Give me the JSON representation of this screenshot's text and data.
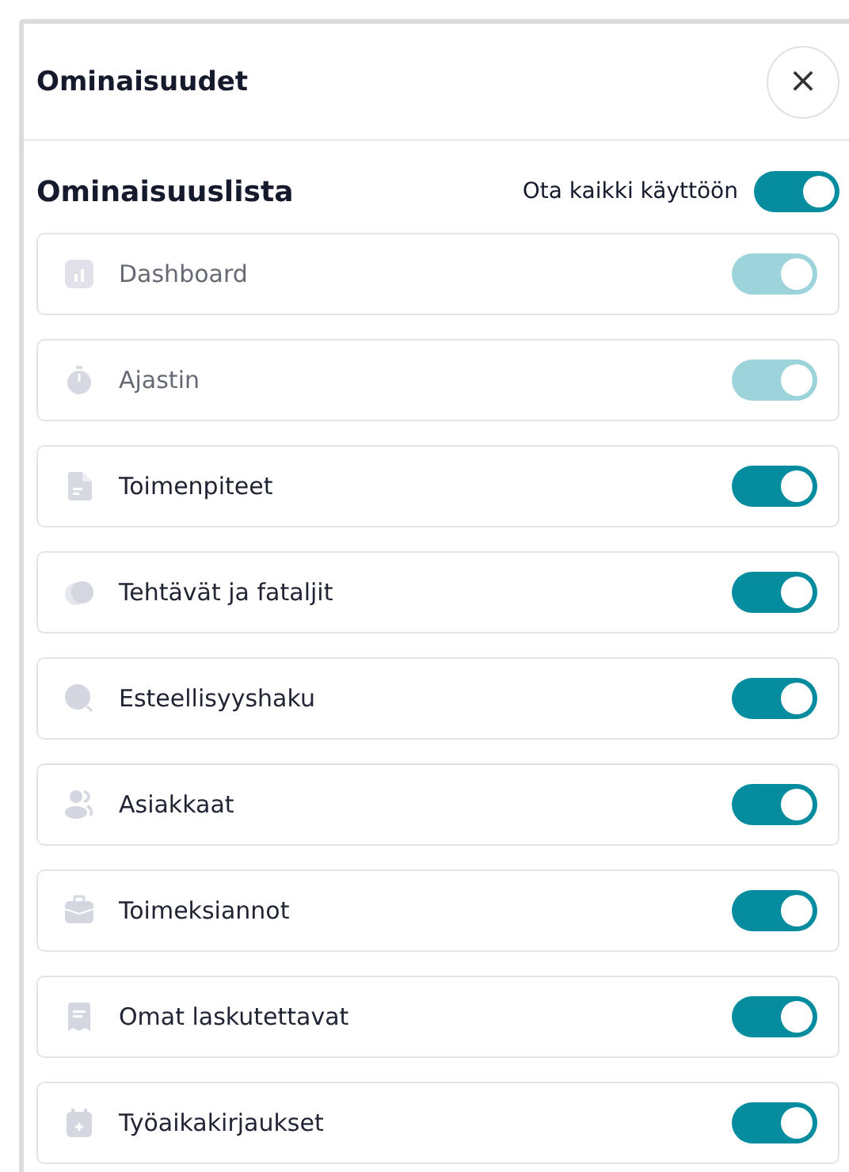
{
  "panel": {
    "title": "Ominaisuudet",
    "close_label": "×"
  },
  "section": {
    "title": "Ominaisuuslista",
    "enable_all_label": "Ota kaikki käyttöön",
    "enable_all_on": true
  },
  "features": [
    {
      "label": "Dashboard",
      "kind": "chart",
      "on": true,
      "disabled": true
    },
    {
      "label": "Ajastin",
      "kind": "stopwatch",
      "on": true,
      "disabled": true
    },
    {
      "label": "Toimenpiteet",
      "kind": "document",
      "on": true,
      "disabled": false
    },
    {
      "label": "Tehtävät ja fataljit",
      "kind": "cards",
      "on": true,
      "disabled": false
    },
    {
      "label": "Esteellisyyshaku",
      "kind": "search",
      "on": true,
      "disabled": false
    },
    {
      "label": "Asiakkaat",
      "kind": "people",
      "on": true,
      "disabled": false
    },
    {
      "label": "Toimeksiannot",
      "kind": "briefcase",
      "on": true,
      "disabled": false
    },
    {
      "label": "Omat laskutettavat",
      "kind": "receipt",
      "on": true,
      "disabled": false
    },
    {
      "label": "Työaikakirjaukset",
      "kind": "calendar",
      "on": true,
      "disabled": false
    }
  ]
}
